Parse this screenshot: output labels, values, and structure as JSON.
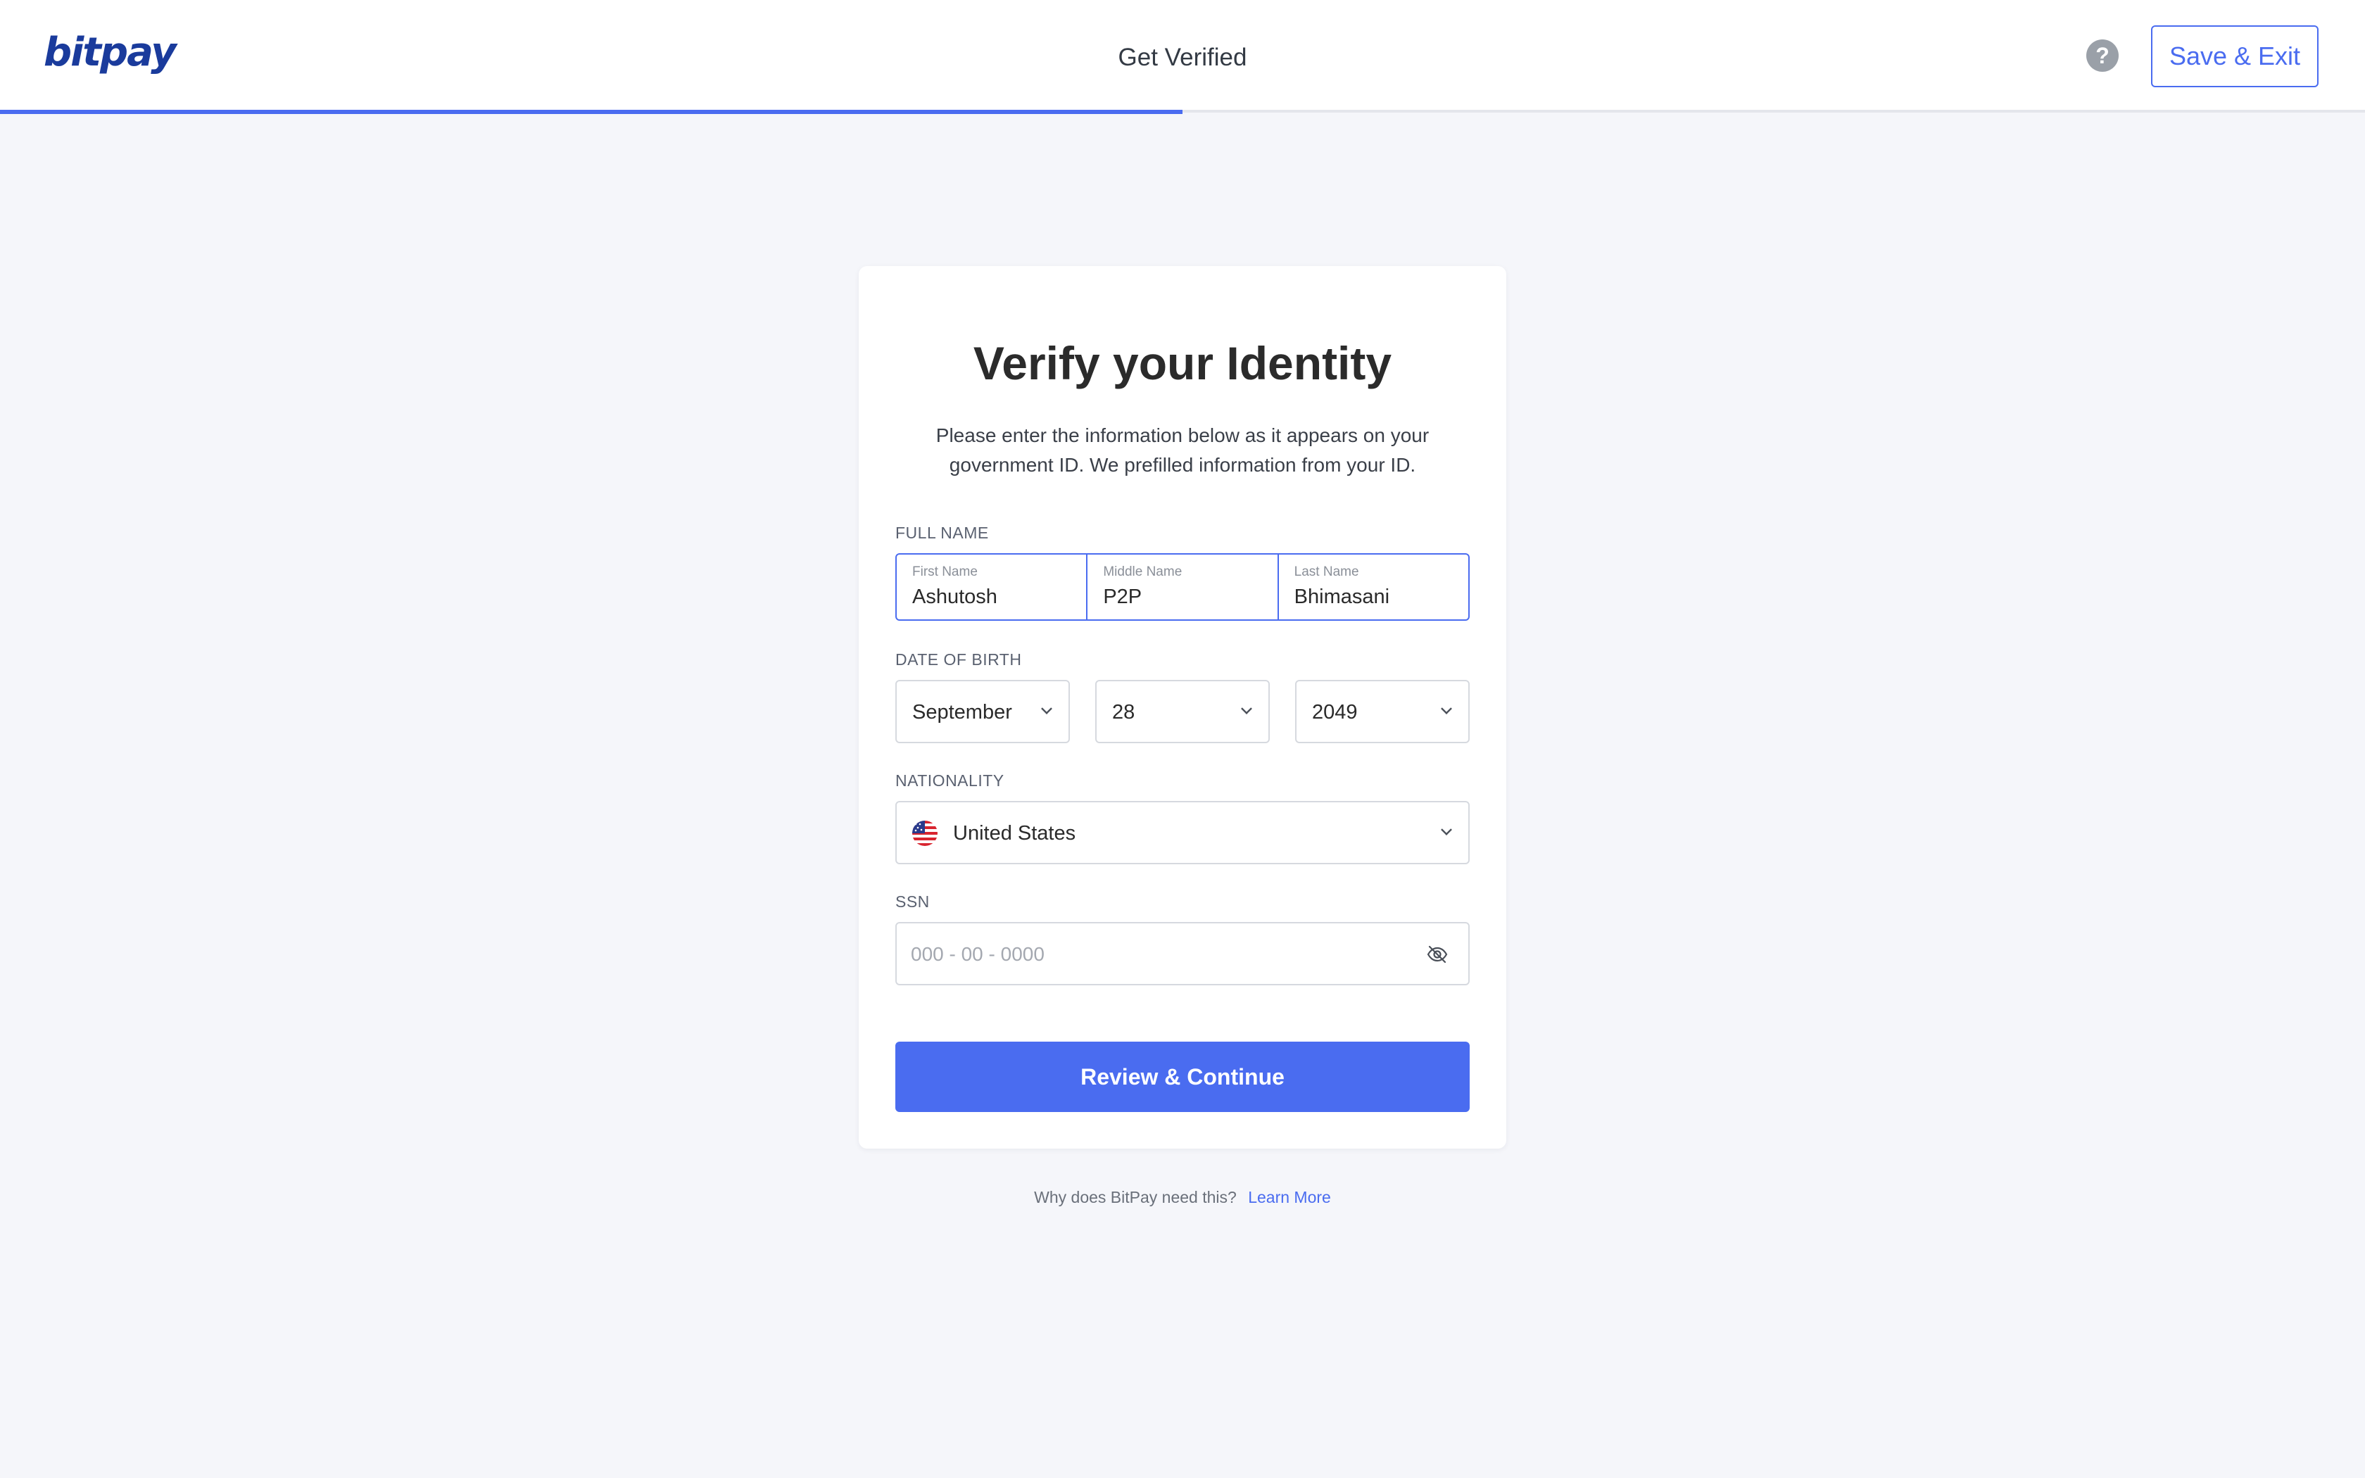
{
  "header": {
    "logo": "bitpay",
    "title": "Get Verified",
    "help_icon": "help-circle-icon",
    "save_exit_label": "Save & Exit",
    "progress_fraction": 0.5
  },
  "card": {
    "title": "Verify your Identity",
    "description": "Please enter the information below as it appears on your government ID. We prefilled information from your ID.",
    "full_name": {
      "label": "FULL NAME",
      "first": {
        "label": "First Name",
        "value": "Ashutosh"
      },
      "middle": {
        "label": "Middle Name",
        "value": "P2P"
      },
      "last": {
        "label": "Last Name",
        "value": "Bhimasani"
      }
    },
    "dob": {
      "label": "DATE OF BIRTH",
      "month": "September",
      "day": "28",
      "year": "2049"
    },
    "nationality": {
      "label": "NATIONALITY",
      "value": "United States",
      "flag_icon": "us-flag-icon"
    },
    "ssn": {
      "label": "SSN",
      "placeholder": "000 - 00 - 0000",
      "value": "",
      "toggle_icon": "eye-off-icon"
    },
    "submit_label": "Review & Continue"
  },
  "footer": {
    "question": "Why does BitPay need this?",
    "link": "Learn More"
  },
  "colors": {
    "accent": "#4a6cf0",
    "brand": "#1a3b9c",
    "background": "#f5f6fa"
  }
}
